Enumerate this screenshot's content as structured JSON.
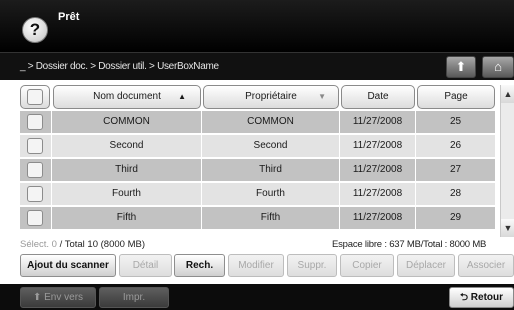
{
  "window": {
    "title": "Prêt",
    "help_glyph": "?"
  },
  "breadcrumb": "_ > Dossier doc. > Dossier util. > UserBoxName",
  "table": {
    "columns": {
      "name": "Nom document",
      "owner": "Propriétaire",
      "date": "Date",
      "page": "Page"
    },
    "rows": [
      {
        "name": "COMMON",
        "owner": "COMMON",
        "date": "11/27/2008",
        "page": "25"
      },
      {
        "name": "Second",
        "owner": "Second",
        "date": "11/27/2008",
        "page": "26"
      },
      {
        "name": "Third",
        "owner": "Third",
        "date": "11/27/2008",
        "page": "27"
      },
      {
        "name": "Fourth",
        "owner": "Fourth",
        "date": "11/27/2008",
        "page": "28"
      },
      {
        "name": "Fifth",
        "owner": "Fifth",
        "date": "11/27/2008",
        "page": "29"
      }
    ]
  },
  "status": {
    "selected": "Sélect. 0",
    "total": "/ Total 10 (8000 MB)",
    "free": "Espace libre : 637 MB/Total : 8000 MB"
  },
  "actions": {
    "add_scanner": "Ajout du scanner",
    "detail": "Détail",
    "search": "Rech.",
    "modify": "Modifier",
    "delete": "Suppr.",
    "copy": "Copier",
    "move": "Déplacer",
    "associate": "Associer"
  },
  "footer": {
    "send": "Env vers",
    "print": "Impr.",
    "back": "Retour"
  },
  "icons": {
    "sort_asc": "▲",
    "sort_desc": "▼",
    "scroll_up": "▲",
    "scroll_down": "▼",
    "send": "⬆",
    "back": "⮌",
    "home": "⌂",
    "upload": "⬆"
  },
  "colors": {
    "title_bg": "#000000",
    "row_dark": "#c2c2c2",
    "row_light": "#e3e3e3"
  }
}
